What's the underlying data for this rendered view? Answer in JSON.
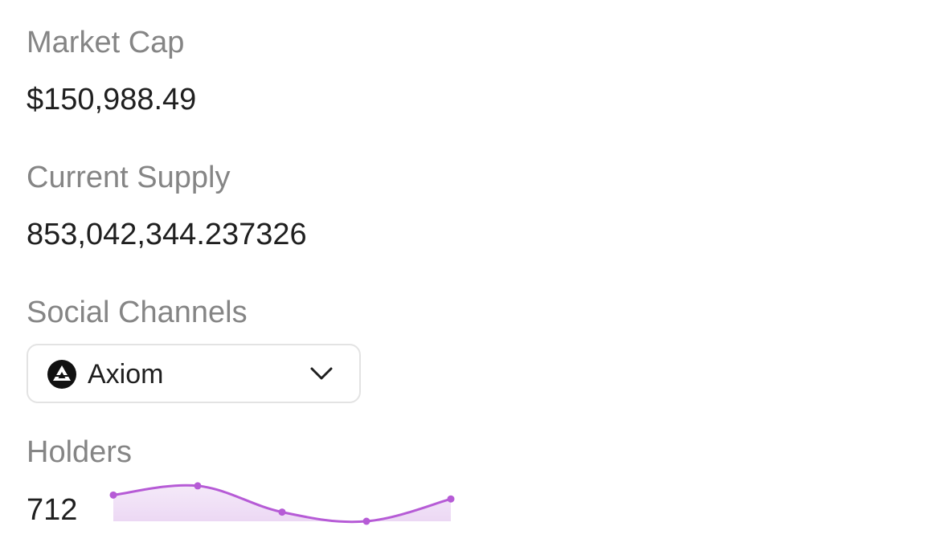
{
  "market_cap": {
    "label": "Market Cap",
    "value": "$150,988.49"
  },
  "current_supply": {
    "label": "Current Supply",
    "value": "853,042,344.237326"
  },
  "social_channels": {
    "label": "Social Channels",
    "selected": "Axiom",
    "selected_icon": "axiom-logo-icon",
    "toggle_icon": "chevron-down-icon"
  },
  "holders": {
    "label": "Holders",
    "value": "712"
  },
  "colors": {
    "label": "#858585",
    "text": "#1f1f1f",
    "sparkline": "#b65bd6",
    "sparkline_fill": "#ecd8f4",
    "border": "#e3e3e3"
  },
  "chart_data": {
    "type": "line",
    "x": [
      0,
      1,
      2,
      3,
      4
    ],
    "values": [
      4.0,
      5.4,
      1.4,
      0.0,
      3.4
    ],
    "ylim": [
      0,
      6
    ],
    "grid": false,
    "axes_visible": false
  }
}
